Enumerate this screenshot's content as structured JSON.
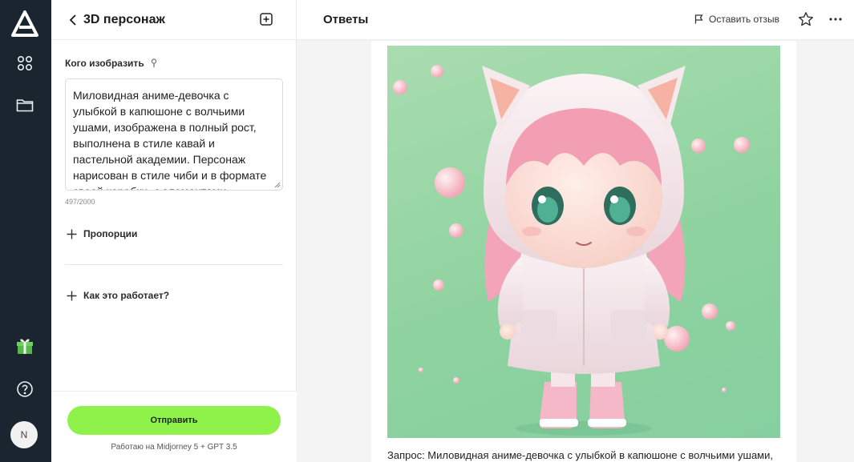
{
  "app": {
    "nav": {
      "logo": "logo-icon",
      "items": [
        {
          "icon": "apps-grid-icon"
        },
        {
          "icon": "folder-icon"
        },
        {
          "icon": "gift-icon"
        },
        {
          "icon": "help-icon"
        }
      ],
      "avatar_initial": "N"
    }
  },
  "panel": {
    "title": "3D персонаж",
    "field_label": "Кого изобразить",
    "prompt_value": "Миловидная аниме-девочка с улыбкой в капюшоне с волчьими ушами, изображена в полный рост, выполнена в стиле кавай и пастельной академии. Персонаж нарисован в стиле чиби и в формате своей коробки, с элементами",
    "char_count": "497/2000",
    "expanders": [
      "Пропорции",
      "Как это работает?"
    ],
    "send_label": "Отправить",
    "powered_by": "Работаю на Midjorney 5 + GPT 3.5"
  },
  "answers": {
    "title": "Ответы",
    "feedback_label": "Оставить отзыв",
    "caption": "Запрос: Миловидная аниме-девочка с улыбкой в капюшоне с волчьими ушами,"
  },
  "colors": {
    "rail_bg": "#1a2530",
    "accent_green": "#8ef24a",
    "image_bg": "#9fd8aa"
  }
}
